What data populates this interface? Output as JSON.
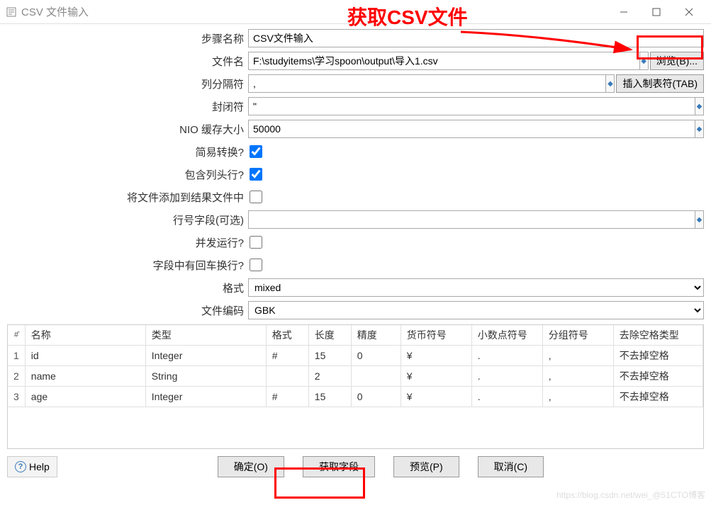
{
  "window": {
    "title": "CSV 文件输入"
  },
  "annotation": {
    "text": "获取CSV文件"
  },
  "form": {
    "stepNameLabel": "步骤名称",
    "stepName": "CSV文件输入",
    "fileNameLabel": "文件名",
    "fileName": "F:\\studyitems\\学习spoon\\output\\导入1.csv",
    "browseBtn": "浏览(B)...",
    "delimiterLabel": "列分隔符",
    "delimiter": ",",
    "tabBtn": "插入制表符(TAB)",
    "enclosureLabel": "封闭符",
    "enclosure": "\"",
    "bufferLabel": "NIO 缓存大小",
    "buffer": "50000",
    "lazyLabel": "简易转换?",
    "headerLabel": "包含列头行?",
    "addResultLabel": "将文件添加到结果文件中",
    "rowNumLabel": "行号字段(可选)",
    "rowNum": "",
    "parallelLabel": "并发运行?",
    "newlineLabel": "字段中有回车换行?",
    "formatLabel": "格式",
    "format": "mixed",
    "encodingLabel": "文件编码",
    "encoding": "GBK"
  },
  "table": {
    "headers": {
      "num": "#̂",
      "name": "名称",
      "type": "类型",
      "format": "格式",
      "length": "长度",
      "precision": "精度",
      "currency": "货币符号",
      "decimal": "小数点符号",
      "group": "分组符号",
      "trim": "去除空格类型"
    },
    "rows": [
      {
        "num": "1",
        "name": "id",
        "type": "Integer",
        "format": "#",
        "length": "15",
        "precision": "0",
        "currency": "¥",
        "decimal": ".",
        "group": ",",
        "trim": "不去掉空格"
      },
      {
        "num": "2",
        "name": "name",
        "type": "String",
        "format": "",
        "length": "2",
        "precision": "",
        "currency": "¥",
        "decimal": ".",
        "group": ",",
        "trim": "不去掉空格"
      },
      {
        "num": "3",
        "name": "age",
        "type": "Integer",
        "format": "#",
        "length": "15",
        "precision": "0",
        "currency": "¥",
        "decimal": ".",
        "group": ",",
        "trim": "不去掉空格"
      }
    ]
  },
  "buttons": {
    "help": "Help",
    "ok": "确定(O)",
    "getFields": "获取字段",
    "preview": "预览(P)",
    "cancel": "取消(C)"
  },
  "watermark": "https://blog.csdn.net/wei_@51CTO博客"
}
